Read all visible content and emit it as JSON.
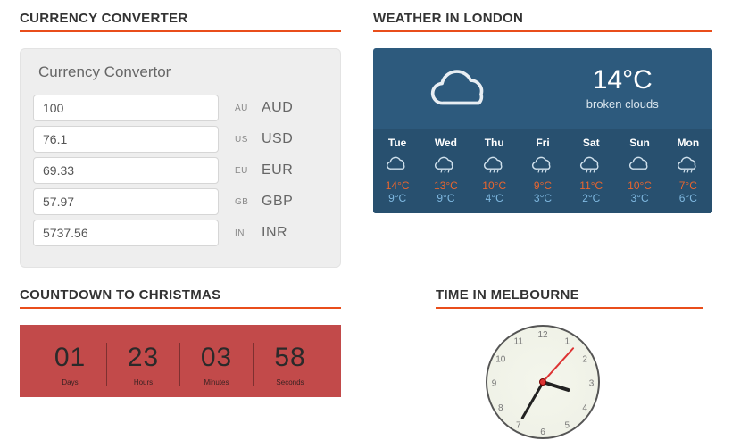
{
  "currency": {
    "title": "CURRENCY CONVERTER",
    "card_title": "Currency Convertor",
    "rows": [
      {
        "value": "100",
        "small": "AU",
        "code": "AUD"
      },
      {
        "value": "76.1",
        "small": "US",
        "code": "USD"
      },
      {
        "value": "69.33",
        "small": "EU",
        "code": "EUR"
      },
      {
        "value": "57.97",
        "small": "GB",
        "code": "GBP"
      },
      {
        "value": "5737.56",
        "small": "IN",
        "code": "INR"
      }
    ]
  },
  "weather": {
    "title": "WEATHER IN LONDON",
    "now_temp": "14°C",
    "now_desc": "broken clouds",
    "days": [
      {
        "name": "Tue",
        "icon": "cloud",
        "hi": "14°C",
        "lo": "9°C"
      },
      {
        "name": "Wed",
        "icon": "cloud-rain",
        "hi": "13°C",
        "lo": "9°C"
      },
      {
        "name": "Thu",
        "icon": "cloud-rain",
        "hi": "10°C",
        "lo": "4°C"
      },
      {
        "name": "Fri",
        "icon": "cloud-rain",
        "hi": "9°C",
        "lo": "3°C"
      },
      {
        "name": "Sat",
        "icon": "cloud-rain",
        "hi": "11°C",
        "lo": "2°C"
      },
      {
        "name": "Sun",
        "icon": "cloud",
        "hi": "10°C",
        "lo": "3°C"
      },
      {
        "name": "Mon",
        "icon": "cloud-rain",
        "hi": "7°C",
        "lo": "6°C"
      }
    ]
  },
  "countdown": {
    "title": "COUNTDOWN TO CHRISTMAS",
    "cells": [
      {
        "value": "01",
        "label": "Days"
      },
      {
        "value": "23",
        "label": "Hours"
      },
      {
        "value": "03",
        "label": "Minutes"
      },
      {
        "value": "58",
        "label": "Seconds"
      }
    ]
  },
  "clock": {
    "title": "TIME IN MELBOURNE",
    "hour": 3,
    "minute": 35,
    "second": 7,
    "numbers": [
      "12",
      "1",
      "2",
      "3",
      "4",
      "5",
      "6",
      "7",
      "8",
      "9",
      "10",
      "11"
    ]
  }
}
